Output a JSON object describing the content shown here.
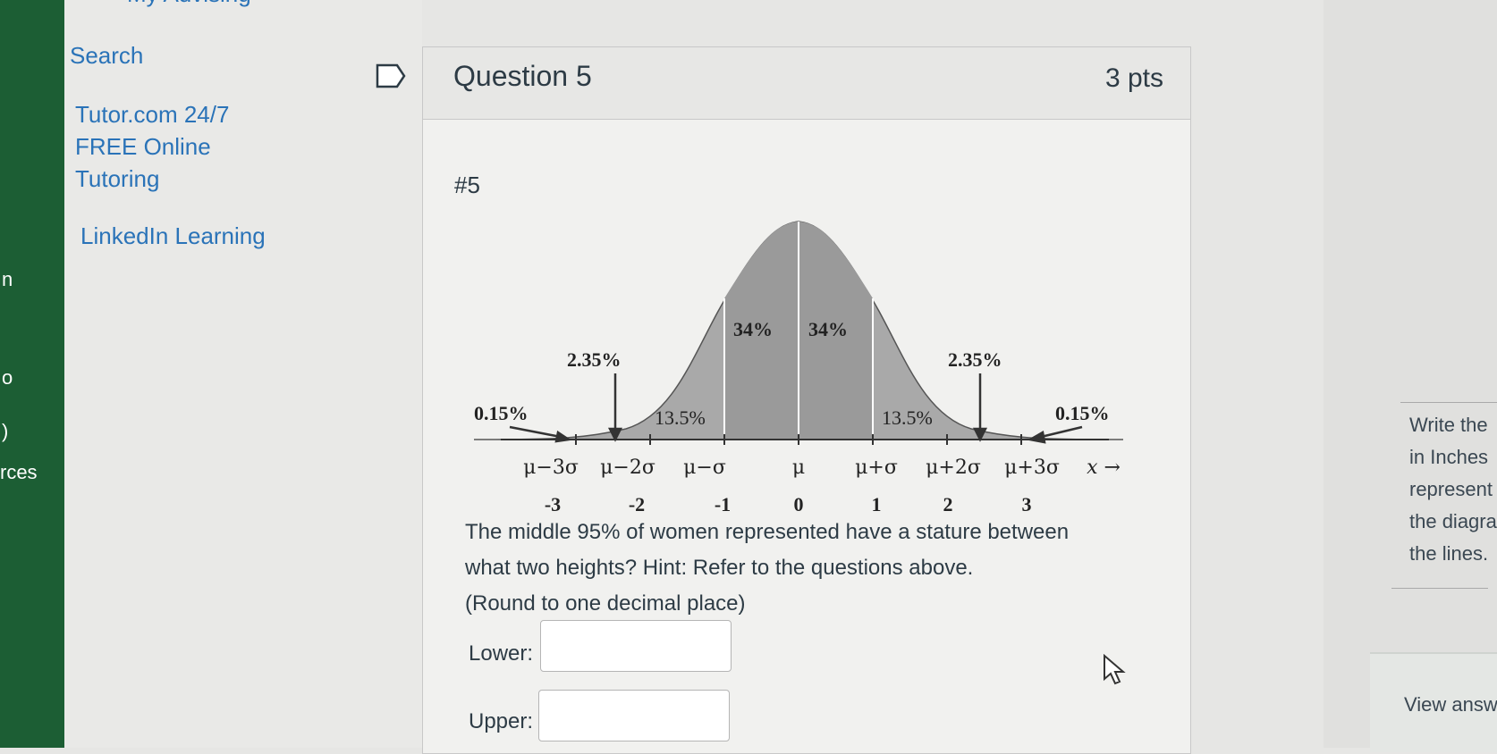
{
  "left_rail": {
    "items": [
      "n",
      "o",
      ")",
      "rces"
    ]
  },
  "nav": {
    "top_cut_label": "My Advising",
    "links": [
      {
        "label": "Search"
      },
      {
        "label": "Tutor.com 24/7\nFREE Online\nTutoring"
      },
      {
        "label": "LinkedIn Learning"
      }
    ]
  },
  "question": {
    "title": "Question 5",
    "points": "3 pts",
    "number_label": "#5",
    "text_lines": [
      "The middle 95% of women represented have a stature between",
      "what two heights? Hint: Refer to the questions above.",
      "(Round to one decimal place)"
    ],
    "lower_label": "Lower:",
    "upper_label": "Upper:",
    "lower_value": "",
    "upper_value": ""
  },
  "diagram": {
    "region_labels": {
      "center_left": "34%",
      "center_right": "34%",
      "inner_left": "13.5%",
      "inner_right": "13.5%",
      "outer_left": "2.35%",
      "outer_right": "2.35%",
      "tail_left": "0.15%",
      "tail_right": "0.15%"
    },
    "mu_labels": [
      "μ−3σ",
      "μ−2σ",
      "μ−σ",
      "μ",
      "μ+σ",
      "μ+2σ",
      "μ+3σ"
    ],
    "x_arrow_label": "x →",
    "z_labels": [
      "-3",
      "-2",
      "-1",
      "0",
      "1",
      "2",
      "3"
    ]
  },
  "right_panel": {
    "hint_lines": "Write the\nin Inches\nrepresent\nthe diagra\nthe lines.",
    "view_answer_label": "View answ"
  }
}
